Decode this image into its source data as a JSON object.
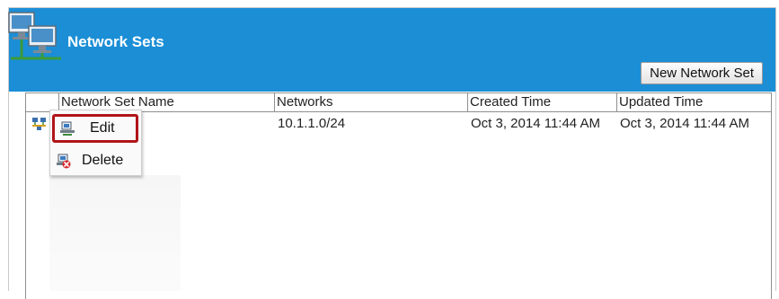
{
  "panel": {
    "title": "Network Sets",
    "new_button_label": "New Network Set"
  },
  "table": {
    "columns": [
      "Network Set Name",
      "Networks",
      "Created Time",
      "Updated Time"
    ],
    "rows": [
      {
        "name": "",
        "networks": "10.1.1.0/24",
        "created": "Oct 3, 2014 11:44 AM",
        "updated": "Oct 3, 2014 11:44 AM"
      }
    ]
  },
  "context_menu": {
    "items": [
      {
        "label": "Edit",
        "icon": "edit-network-icon"
      },
      {
        "label": "Delete",
        "icon": "delete-network-icon"
      }
    ]
  },
  "colors": {
    "header_blue": "#1b8ed6",
    "highlight_red": "#b01418"
  }
}
